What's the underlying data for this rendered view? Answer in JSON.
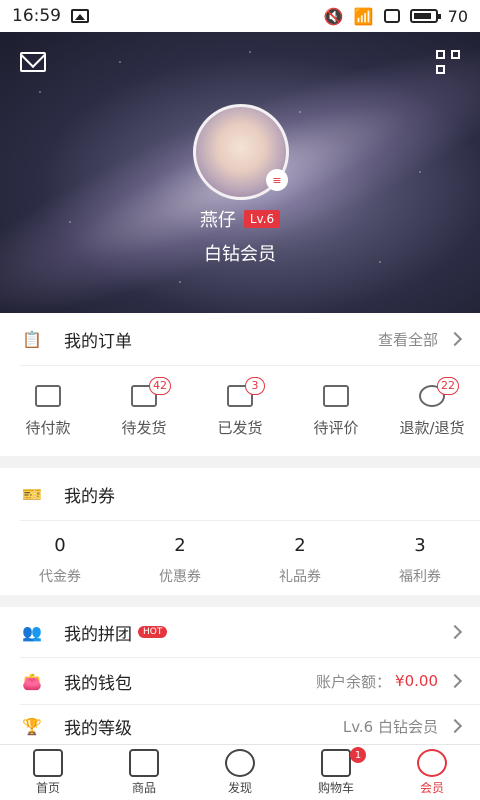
{
  "status_bar": {
    "time": "16:59",
    "battery": "70"
  },
  "profile": {
    "username": "燕仔",
    "level_tag": "Lv.6",
    "member_level": "白钻会员"
  },
  "orders": {
    "title": "我的订单",
    "view_all": "查看全部",
    "items": [
      {
        "label": "待付款",
        "badge": ""
      },
      {
        "label": "待发货",
        "badge": "42"
      },
      {
        "label": "已发货",
        "badge": "3"
      },
      {
        "label": "待评价",
        "badge": ""
      },
      {
        "label": "退款/退货",
        "badge": "22"
      }
    ]
  },
  "coupons": {
    "title": "我的券",
    "items": [
      {
        "count": "0",
        "label": "代金券"
      },
      {
        "count": "2",
        "label": "优惠券"
      },
      {
        "count": "2",
        "label": "礼品券"
      },
      {
        "count": "3",
        "label": "福利券"
      }
    ]
  },
  "groupbuy": {
    "title": "我的拼团",
    "tag": "HOT"
  },
  "wallet": {
    "title": "我的钱包",
    "balance_label": "账户余额：",
    "balance_value": "¥0.00"
  },
  "level": {
    "title": "我的等级",
    "value": "Lv.6 白钻会员"
  },
  "bottom_nav": [
    {
      "label": "首页"
    },
    {
      "label": "商品"
    },
    {
      "label": "发现"
    },
    {
      "label": "购物车",
      "badge": "1"
    },
    {
      "label": "会员"
    }
  ],
  "colors": {
    "accent": "#e5363f"
  }
}
